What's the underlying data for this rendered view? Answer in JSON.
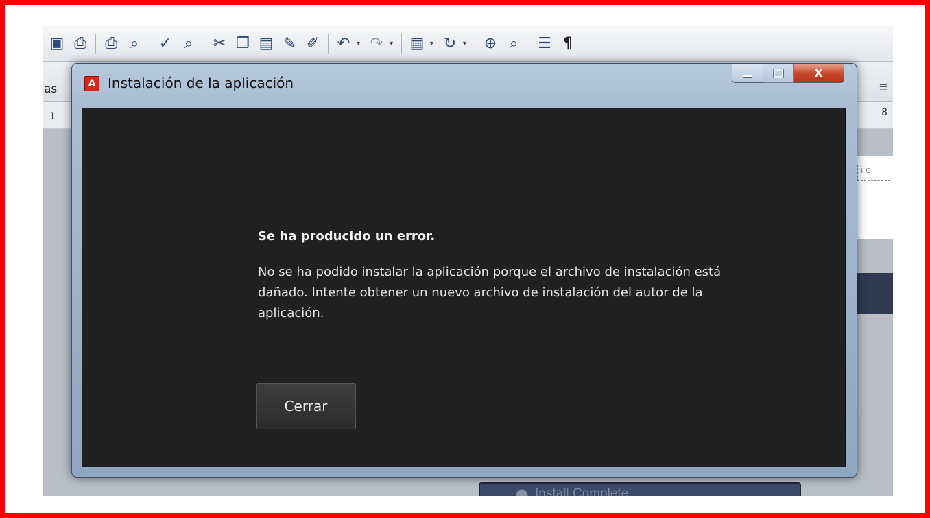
{
  "background_app": {
    "toolbar_icons": [
      "save-icon",
      "permission-icon",
      "print-icon",
      "print-preview-icon",
      "spellcheck-icon",
      "research-icon",
      "cut-icon",
      "copy-icon",
      "paste-icon",
      "format-painter-icon",
      "brush-icon",
      "undo-icon",
      "redo-icon",
      "insert-icon",
      "refresh-icon",
      "hyperlink-icon",
      "document-map-icon",
      "columns-icon",
      "pilcrow-icon"
    ],
    "pilcrow_glyph": "¶",
    "toolbar2_left_text": "as",
    "ruler_left_mark": "1",
    "ruler_right_mark": "8",
    "status_label": "Install Complete"
  },
  "dialog": {
    "title": "Instalación de la aplicación",
    "app_icon_glyph": "A",
    "close_glyph": "X",
    "error_heading": "Se ha producido un error.",
    "error_message": "No se ha podido instalar la aplicación porque el archivo de instalación está dañado. Intente obtener un nuevo archivo de instalación del autor de la aplicación.",
    "close_button_label": "Cerrar"
  },
  "colors": {
    "frame_border": "#ff0000",
    "dialog_client_bg": "#212121",
    "app_icon_red": "#d7261e"
  }
}
